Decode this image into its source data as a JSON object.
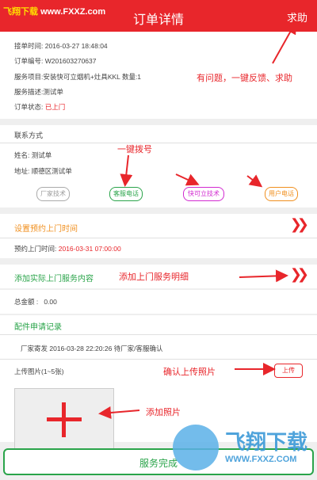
{
  "header": {
    "title": "订单详情",
    "help_label": "求助"
  },
  "watermark_top": {
    "brand": "飞翔下载",
    "url": "www.FXXZ.com"
  },
  "order_info": {
    "dispatch_time": "接单时间: 2016-03-27 18:48:04",
    "order_no": "订单编号: W201603270637",
    "service_item": "服务项目:安装快可立烟机+灶具KKL 数量:1",
    "service_desc": "服务描述:测试单",
    "status_label": "订单状态:",
    "status_value": "已上门"
  },
  "contact": {
    "title": "联系方式",
    "name": "姓名: 测试单",
    "address": "地址: 顺德区测试单",
    "buttons": [
      "厂家技术",
      "客服电话",
      "快可立技术",
      "用户电话"
    ]
  },
  "appointment": {
    "title": "设置预约上门时间",
    "time_label": "预约上门时间:",
    "time_value": "2016-03-31 07:00:00"
  },
  "service_detail": {
    "title": "添加实际上门服务内容"
  },
  "total": {
    "label": "总金额 :",
    "value": "0.00"
  },
  "parts": {
    "title": "配件申请记录",
    "record": "厂家寄发 2016-03-28 22:20:26 待厂家/客服确认",
    "upload_label": "上传图片(1~5张)",
    "upload_button": "上传"
  },
  "annotations": {
    "help": "有问题，一键反馈、求助",
    "dial": "一键拨号",
    "service": "添加上门服务明细",
    "upload": "确认上传照片",
    "add_photo": "添加照片"
  },
  "submit_label": "服务完成",
  "watermark_logo": {
    "big": "飞翔下载",
    "url": "WWW.FXXZ.COM"
  },
  "colors": {
    "header": "#e8262b",
    "annotation": "#e8262b",
    "orange": "#f08f1e",
    "green": "#2aa44a",
    "magenta": "#d22ad0",
    "gray": "#999999"
  }
}
